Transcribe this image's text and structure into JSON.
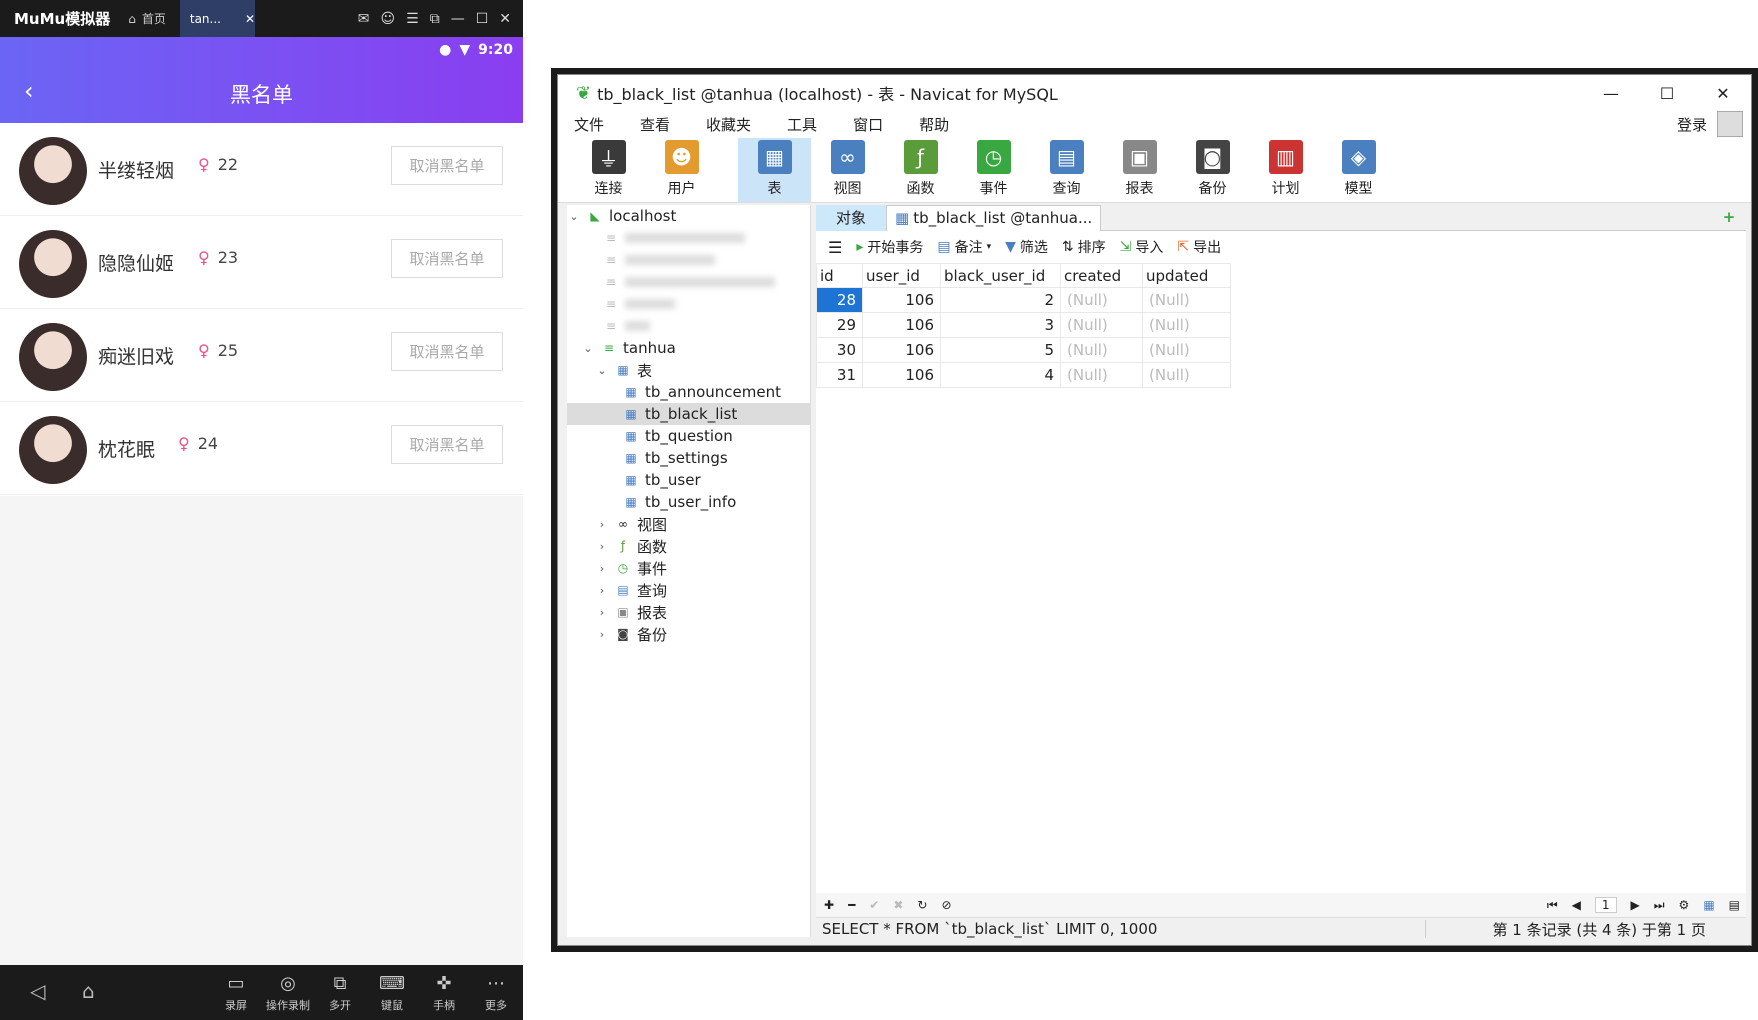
{
  "emulator": {
    "app_name": "MuMu模拟器",
    "home_label": "首页",
    "tab_label": "tan...",
    "status_time": "9:20",
    "page_title": "黑名单",
    "users": [
      {
        "name": "半缕轻烟",
        "age": "22",
        "button": "取消黑名单"
      },
      {
        "name": "隐隐仙姬",
        "age": "23",
        "button": "取消黑名单"
      },
      {
        "name": "痴迷旧戏",
        "age": "25",
        "button": "取消黑名单"
      },
      {
        "name": "枕花眠",
        "age": "24",
        "button": "取消黑名单"
      }
    ],
    "bottom_tools": [
      "录屏",
      "操作录制",
      "多开",
      "键鼠",
      "手柄",
      "更多"
    ]
  },
  "navicat": {
    "window_title": "tb_black_list @tanhua (localhost) - 表 - Navicat for MySQL",
    "menu": [
      "文件",
      "查看",
      "收藏夹",
      "工具",
      "窗口",
      "帮助"
    ],
    "login_label": "登录",
    "toolbar": [
      {
        "label": "连接",
        "icon": "plug-icon",
        "color": "#3a3a3a"
      },
      {
        "label": "用户",
        "icon": "user-icon",
        "color": "#e39a2e"
      },
      {
        "label": "表",
        "icon": "table-icon",
        "color": "#4a7fc0"
      },
      {
        "label": "视图",
        "icon": "view-icon",
        "color": "#4a7fc0"
      },
      {
        "label": "函数",
        "icon": "function-icon",
        "color": "#5a9b3a"
      },
      {
        "label": "事件",
        "icon": "event-icon",
        "color": "#3aa840"
      },
      {
        "label": "查询",
        "icon": "query-icon",
        "color": "#4a7fc0"
      },
      {
        "label": "报表",
        "icon": "report-icon",
        "color": "#888"
      },
      {
        "label": "备份",
        "icon": "backup-icon",
        "color": "#444"
      },
      {
        "label": "计划",
        "icon": "schedule-icon",
        "color": "#c33"
      },
      {
        "label": "模型",
        "icon": "model-icon",
        "color": "#4a7fc0"
      }
    ],
    "tree": {
      "connection": "localhost",
      "database": "tanhua",
      "tables_group": "表",
      "tables": [
        "tb_announcement",
        "tb_black_list",
        "tb_question",
        "tb_settings",
        "tb_user",
        "tb_user_info"
      ],
      "selected_table": "tb_black_list",
      "other_groups": [
        "视图",
        "函数",
        "事件",
        "查询",
        "报表",
        "备份"
      ]
    },
    "tabs": {
      "objects": "对象",
      "active": "tb_black_list @tanhua..."
    },
    "subtoolbar": [
      "开始事务",
      "备注",
      "筛选",
      "排序",
      "导入",
      "导出"
    ],
    "grid": {
      "columns": [
        "id",
        "user_id",
        "black_user_id",
        "created",
        "updated"
      ],
      "rows": [
        [
          "28",
          "106",
          "2",
          "(Null)",
          "(Null)"
        ],
        [
          "29",
          "106",
          "3",
          "(Null)",
          "(Null)"
        ],
        [
          "30",
          "106",
          "5",
          "(Null)",
          "(Null)"
        ],
        [
          "31",
          "106",
          "4",
          "(Null)",
          "(Null)"
        ]
      ]
    },
    "page_number": "1",
    "sql": "SELECT * FROM `tb_black_list` LIMIT 0, 1000",
    "record_info": "第 1 条记录 (共 4 条) 于第 1 页"
  }
}
